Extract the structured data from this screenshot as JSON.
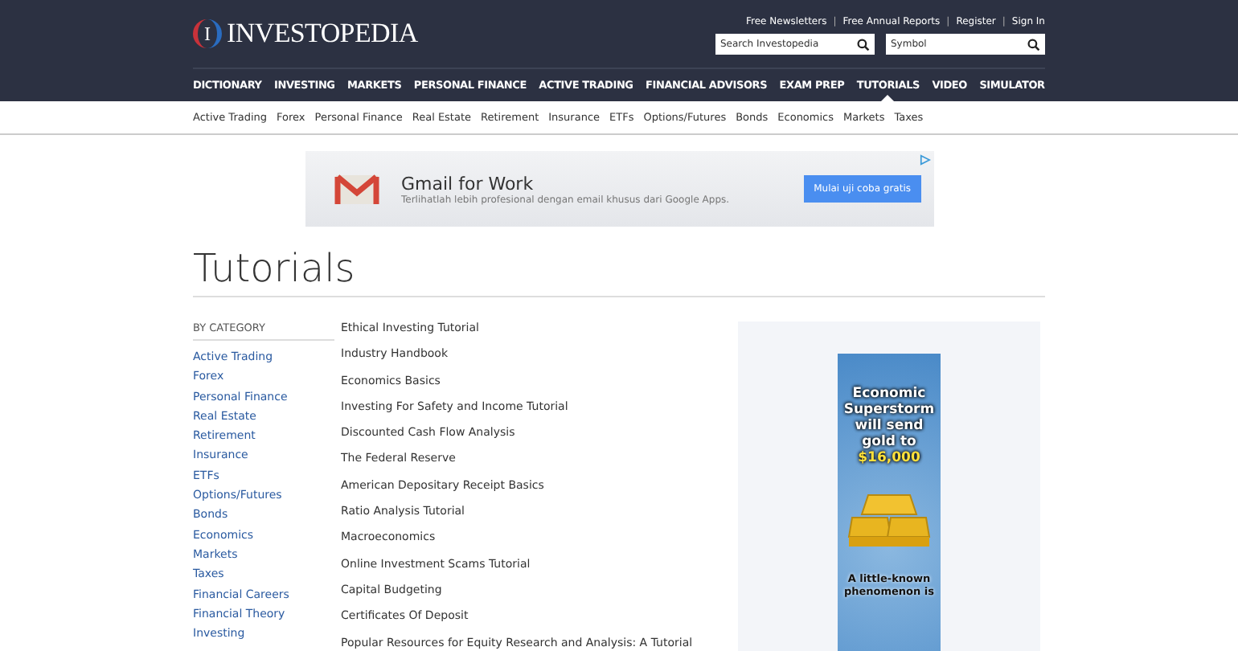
{
  "header": {
    "logo_mark": "I",
    "logo_text": "INVESTOPEDIA",
    "top_links": [
      {
        "kind": "link",
        "text": "Free Newsletters"
      },
      {
        "kind": "separator",
        "text": "|"
      },
      {
        "kind": "link",
        "text": "Free Annual Reports"
      },
      {
        "kind": "separator",
        "text": "|"
      },
      {
        "kind": "link",
        "text": "Register"
      },
      {
        "kind": "separator",
        "text": "|"
      },
      {
        "kind": "link",
        "text": "Sign In"
      }
    ],
    "search": {
      "placeholder": "Search Investopedia"
    },
    "symbol": {
      "placeholder": "Symbol"
    }
  },
  "main_nav": [
    {
      "label": "DICTIONARY",
      "selected": false
    },
    {
      "label": "INVESTING",
      "selected": false
    },
    {
      "label": "MARKETS",
      "selected": false
    },
    {
      "label": "PERSONAL FINANCE",
      "selected": false
    },
    {
      "label": "ACTIVE TRADING",
      "selected": false
    },
    {
      "label": "FINANCIAL ADVISORS",
      "selected": false
    },
    {
      "label": "EXAM PREP",
      "selected": false
    },
    {
      "label": "TUTORIALS",
      "selected": true
    },
    {
      "label": "VIDEO",
      "selected": false
    },
    {
      "label": "SIMULATOR",
      "selected": false
    }
  ],
  "sub_nav": [
    "Active Trading",
    "Forex",
    "Personal Finance",
    "Real Estate",
    "Retirement",
    "Insurance",
    "ETFs",
    "Options/Futures",
    "Bonds",
    "Economics",
    "Markets",
    "Taxes"
  ],
  "banner_ad": {
    "title": "Gmail for Work",
    "text": "Terlihatlah lebih profesional dengan email khusus dari Google Apps.",
    "button": "Mulai uji coba gratis"
  },
  "page_title": "Tutorials",
  "category": {
    "heading": "BY CATEGORY",
    "items": [
      "Active Trading",
      "Forex",
      "Personal Finance",
      "Real Estate",
      "Retirement",
      "Insurance",
      "ETFs",
      "Options/Futures",
      "Bonds",
      "Economics",
      "Markets",
      "Taxes",
      "Financial Careers",
      "Financial Theory",
      "Investing"
    ]
  },
  "tutorials": [
    "Ethical Investing Tutorial",
    "Industry Handbook",
    "Economics Basics",
    "Investing For Safety and Income Tutorial",
    "Discounted Cash Flow Analysis",
    "The Federal Reserve",
    "American Depositary Receipt Basics",
    "Ratio Analysis Tutorial",
    "Macroeconomics",
    "Online Investment Scams Tutorial",
    "Capital Budgeting",
    "Certificates Of Deposit",
    "Popular Resources for Equity Research and Analysis: A Tutorial"
  ],
  "side_ad": {
    "headline": [
      "Economic",
      "Superstorm",
      "will send",
      "gold to"
    ],
    "highlight": "$16,000",
    "footer": [
      "A little-known",
      "phenomenon is"
    ]
  }
}
